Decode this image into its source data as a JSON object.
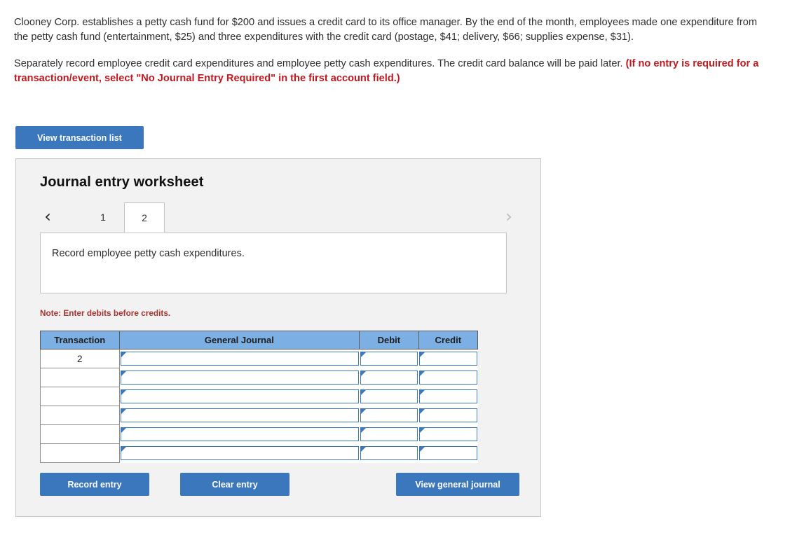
{
  "problem": {
    "paragraph_1": "Clooney Corp. establishes a petty cash fund for $200 and issues a credit card to its office manager. By the end of the month, employees made one expenditure from the petty cash fund (entertainment, $25) and three expenditures with the credit card (postage, $41; delivery, $66; supplies expense, $31).",
    "paragraph_2_lead": "Separately record employee credit card expenditures and employee petty cash expenditures. The credit card balance will be paid later. ",
    "paragraph_2_bold": "(If no entry is required for a transaction/event, select \"No Journal Entry Required\" in the first account field.)"
  },
  "buttons": {
    "view_transaction_list": "View transaction list",
    "record_entry": "Record entry",
    "clear_entry": "Clear entry",
    "view_general_journal": "View general journal"
  },
  "worksheet": {
    "title": "Journal entry worksheet",
    "nav": {
      "prev_icon": "chevron-left-icon",
      "next_icon": "chevron-right-icon",
      "prev_glyph": "‹",
      "next_glyph": "›"
    },
    "tabs": [
      {
        "label": "1",
        "selected": false
      },
      {
        "label": "2",
        "selected": true
      }
    ],
    "instruction": "Record employee petty cash expenditures.",
    "note": "Note: Enter debits before credits."
  },
  "table": {
    "columns": [
      "Transaction",
      "General Journal",
      "Debit",
      "Credit"
    ],
    "rows": [
      {
        "transaction": "2",
        "general_journal": "",
        "debit": "",
        "credit": ""
      },
      {
        "transaction": "",
        "general_journal": "",
        "debit": "",
        "credit": ""
      },
      {
        "transaction": "",
        "general_journal": "",
        "debit": "",
        "credit": ""
      },
      {
        "transaction": "",
        "general_journal": "",
        "debit": "",
        "credit": ""
      },
      {
        "transaction": "",
        "general_journal": "",
        "debit": "",
        "credit": ""
      },
      {
        "transaction": "",
        "general_journal": "",
        "debit": "",
        "credit": ""
      }
    ]
  },
  "colors": {
    "button_blue": "#3b77bd",
    "header_blue": "#7cb0e4",
    "panel_gray": "#f2f2f2",
    "red_bold": "#c0191f",
    "note_red": "#a8332f",
    "input_border_blue": "#3c79b9"
  }
}
